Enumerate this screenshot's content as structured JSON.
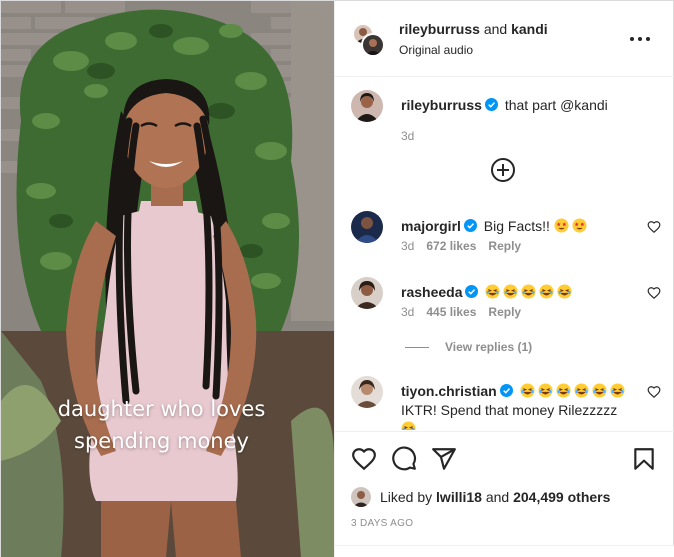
{
  "media": {
    "overlay_line1": "daughter who loves",
    "overlay_line2": "spending money"
  },
  "header": {
    "author": "rileyburruss",
    "joiner": " and ",
    "coauthor": "kandi",
    "audio": "Original audio",
    "more_icon": "more-horizontal-icon"
  },
  "caption": {
    "user": "rileyburruss",
    "text": "that part @kandi",
    "time": "3d"
  },
  "comments": [
    {
      "user": "majorgirl",
      "verified": true,
      "text": "Big Facts!!",
      "emojis": [
        "star-struck",
        "star-struck"
      ],
      "time": "3d",
      "likes": "672 likes",
      "reply": "Reply"
    },
    {
      "user": "rasheeda",
      "verified": true,
      "text": "",
      "emojis": [
        "laughing",
        "laughing",
        "laughing",
        "laughing",
        "laughing"
      ],
      "time": "3d",
      "likes": "445 likes",
      "reply": "Reply"
    },
    {
      "user": "tiyon.christian",
      "verified": true,
      "text": "IKTR! Spend that money Rilezzzzz",
      "emojis": [
        "laughing",
        "laughing",
        "laughing",
        "laughing",
        "laughing",
        "laughing"
      ]
    }
  ],
  "view_replies": "View replies (1)",
  "actions": {
    "like_icon": "heart-icon",
    "comment_icon": "comment-icon",
    "share_icon": "send-icon",
    "save_icon": "bookmark-icon"
  },
  "likes": {
    "prefix": "Liked by ",
    "user": "lwilli18",
    "middle": " and ",
    "count": "204,499 others"
  },
  "date": "3 DAYS AGO",
  "colors": {
    "text": "#262626",
    "muted": "#8e8e8e",
    "verified": "#0095f6",
    "border": "#efefef"
  }
}
